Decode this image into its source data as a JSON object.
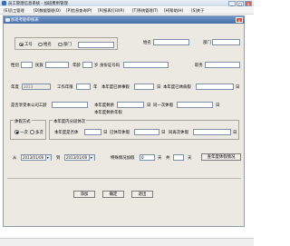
{
  "window": {
    "title": "员工管理信息系统 - 加班费用管理"
  },
  "menu": [
    {
      "label": "[E]员工管理"
    },
    {
      "label": "[D]数据管理(D)"
    },
    {
      "label": "[P]信息查询(P)"
    },
    {
      "label": "[R]报表打印(R)"
    },
    {
      "label": "[T]系统管理(T)"
    },
    {
      "label": "[H]帮助(H)"
    },
    {
      "label": "[S]关于"
    }
  ],
  "child": {
    "title": "加班考勤审核表"
  },
  "search": {
    "options": [
      "工号",
      "姓名",
      "部门"
    ],
    "selected": "工号",
    "input_value": ""
  },
  "fields": {
    "name_label": "姓名",
    "dept_label": "部门",
    "gender_label": "性别",
    "nation_label": "民族",
    "age_label": "年龄",
    "age_unit": "岁",
    "idcard_label": "身份证号码",
    "position_label": "职务",
    "year_label": "年度",
    "year_value": "2013",
    "work_years_label": "工作年限",
    "work_years_unit": "年",
    "used_days_label": "本年度已休事假",
    "used_days_unit": "日",
    "sick_days_label": "本年度已休病假",
    "sick_days_unit": "日",
    "pay_label": "是否享受本公司工龄",
    "remain_label": "本年度剩余",
    "remain_unit": "日",
    "one_label": "同一次休假",
    "one_unit": "日",
    "balance_label": "本年度剩余年假",
    "balance_unit": "日"
  },
  "method_group": {
    "label": "休假方式",
    "options": [
      "一次",
      "多次"
    ],
    "selected": "一次"
  },
  "plan_group": {
    "label": "本年度内分段休次",
    "taken_label": "本年度是否休",
    "taken_unit": "日",
    "already_label": "已休年休假",
    "already_unit": "日",
    "same_label": "同再次休假",
    "same_unit": "日"
  },
  "date_range": {
    "from_label": "从",
    "from_value": "2013/01/08",
    "to_label": "到",
    "to_value": "2013/01/08",
    "special_label": "特殊情况加假",
    "special_value": "0",
    "days_unit": "天",
    "total_label": "共",
    "total_unit": "天",
    "detail_button": "查年度休假情况"
  },
  "buttons": {
    "add": "添加",
    "ok": "确定",
    "exit": "退出"
  }
}
